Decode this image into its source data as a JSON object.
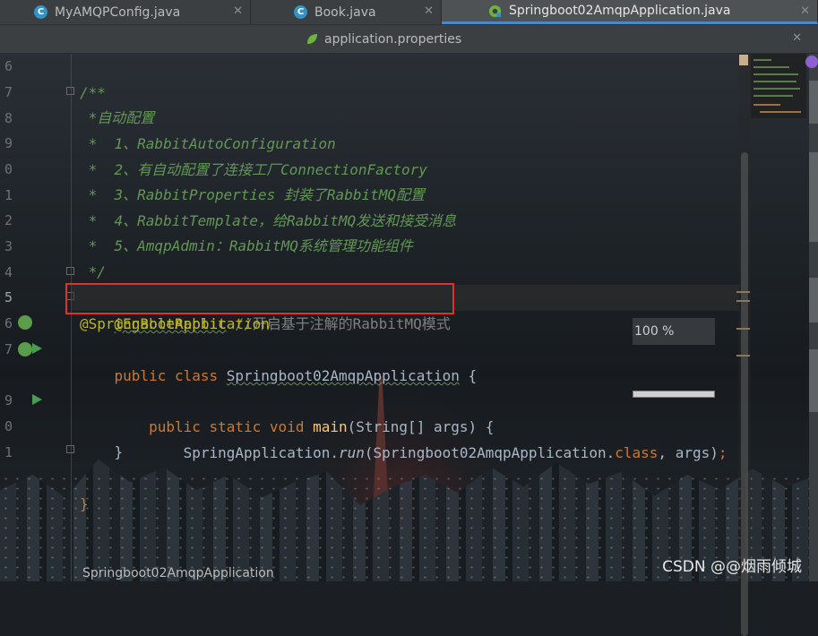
{
  "tabs": [
    {
      "label": "MyAMQPConfig.java",
      "icon": "class-icon",
      "active": false
    },
    {
      "label": "Book.java",
      "icon": "class-icon",
      "active": false
    },
    {
      "label": "Springboot02AmqpApplication.java",
      "icon": "spring-boot-icon",
      "active": true
    }
  ],
  "tab_row2": {
    "label": "application.properties",
    "icon": "spring-leaf-icon"
  },
  "close_glyph": "✕",
  "class_glyph": "C",
  "line_numbers": [
    "6",
    "7",
    "8",
    "9",
    "0",
    "1",
    "2",
    "3",
    "4",
    "5",
    "6",
    "7",
    "",
    "9",
    "0",
    "1",
    "",
    ""
  ],
  "code": {
    "l7": "/**",
    "l8": " *自动配置",
    "l9": " *  1、RabbitAutoConfiguration",
    "l10": " *  2、有自动配置了连接工厂ConnectionFactory",
    "l11": " *  3、RabbitProperties 封装了RabbitMQ配置",
    "l12": " *  4、RabbitTemplate，给RabbitMQ发送和接受消息",
    "l13": " *  5、AmqpAdmin：RabbitMQ系统管理功能组件",
    "l14": " */",
    "l15_ann": "@EnableRabbit",
    "l15_cmt": " //开启基于注解的RabbitMQ模式",
    "l16": "@SpringBootApplication",
    "l17_kw": "public class ",
    "l17_cls": "Springboot02AmqpApplication",
    "l17_br": " {",
    "l19_kw": "    public static void ",
    "l19_fn": "main",
    "l19_rest": "(String[] args) {",
    "l20_a": "        SpringApplication.",
    "l20_b": "run",
    "l20_c": "(Springboot02AmqpApplication.",
    "l20_d": "class",
    "l20_e": ", args)",
    "l20_f": ";",
    "l21": "    }",
    "l23": "}"
  },
  "zoom": {
    "label": "100 %"
  },
  "breadcrumb": "Springboot02AmqpApplication",
  "watermark": "CSDN @@烟雨倾城",
  "colors": {
    "comment": "#629755",
    "annotation": "#bbb529",
    "keyword": "#cc7832",
    "function": "#ffc66d",
    "text": "#a9b7c6",
    "highlight_box": "#e03131"
  }
}
